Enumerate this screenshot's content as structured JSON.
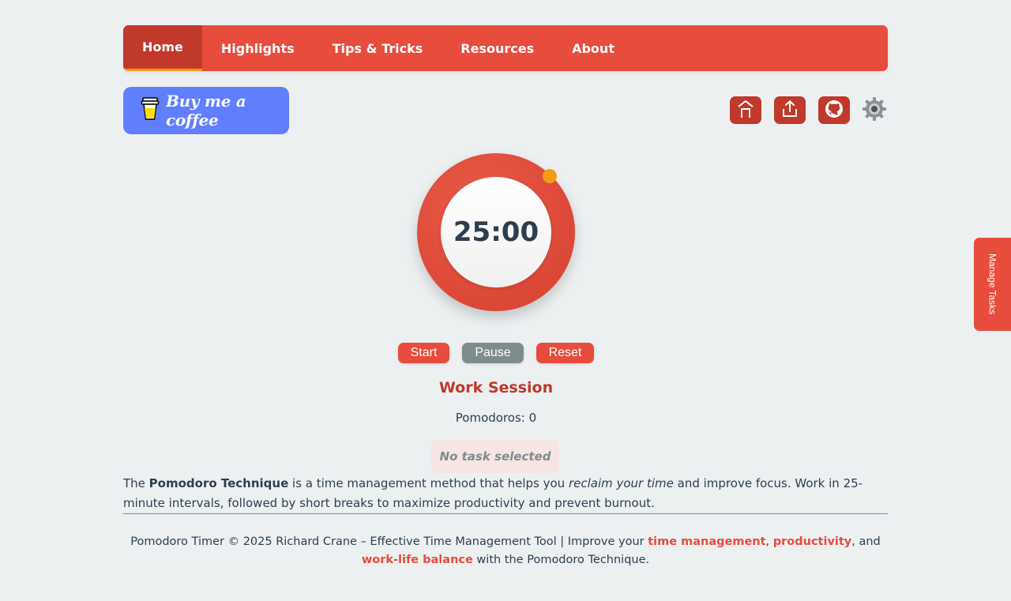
{
  "nav": {
    "items": [
      {
        "label": "Home",
        "active": true
      },
      {
        "label": "Highlights"
      },
      {
        "label": "Tips & Tricks"
      },
      {
        "label": "Resources"
      },
      {
        "label": "About"
      }
    ]
  },
  "coffee": {
    "label": "Buy me a coffee",
    "icon": "coffee-cup-icon",
    "color": "#5f7fff"
  },
  "toolbar": {
    "icons": [
      "home-icon",
      "share-icon",
      "github-icon",
      "gear-icon"
    ]
  },
  "timer": {
    "time": "25:00",
    "progress": 0
  },
  "controls": {
    "start": "Start",
    "pause": "Pause",
    "reset": "Reset"
  },
  "session": {
    "label": "Work Session",
    "pomodoros_label": "Pomodoros:",
    "pomodoros_count": "0"
  },
  "task": {
    "status": "No task selected"
  },
  "description": {
    "p1": "The ",
    "bold": "Pomodoro Technique",
    "p2": " is a time management method that helps you ",
    "italic": "reclaim your time",
    "p3": " and improve focus. Work in 25-minute intervals, followed by short breaks to maximize productivity and prevent burnout."
  },
  "footer": {
    "prefix": "Pomodoro Timer © 2025 Richard Crane – Effective Time Management Tool  |  Improve your ",
    "link1": "time management",
    "sep1": ", ",
    "link2": "productivity",
    "sep2": ", and ",
    "link3": "work-life balance",
    "suffix": " with the Pomodoro Technique."
  },
  "side_tab": {
    "label": "Manage Tasks"
  },
  "colors": {
    "accent": "#e74c3c",
    "accent_dark": "#c0392b",
    "highlight": "#f39c12",
    "pause": "#7f8c8d"
  }
}
